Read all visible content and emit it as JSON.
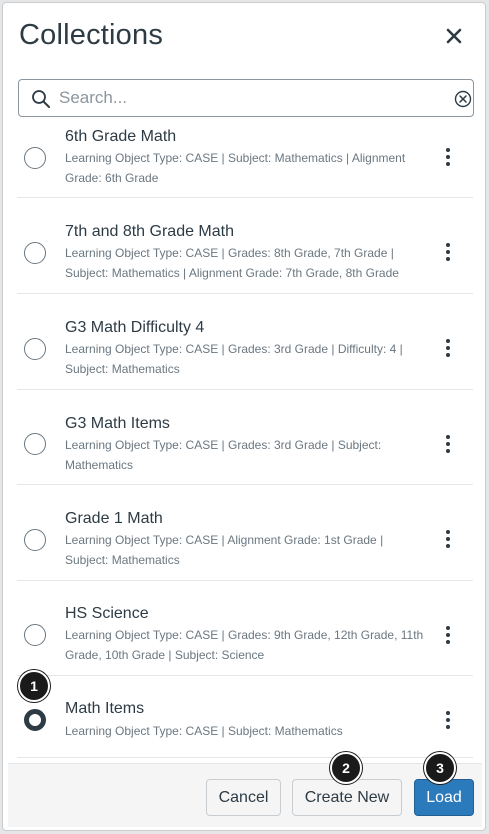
{
  "header": {
    "title": "Collections"
  },
  "search": {
    "placeholder": "Search...",
    "value": ""
  },
  "collections": [
    {
      "name": "6th Grade Math",
      "meta": "Learning Object Type: CASE | Subject: Mathematics | Alignment Grade: 6th Grade",
      "selected": false
    },
    {
      "name": "7th and 8th Grade Math",
      "meta": "Learning Object Type: CASE | Grades: 8th Grade, 7th Grade | Subject: Mathematics | Alignment Grade: 7th Grade, 8th Grade",
      "selected": false
    },
    {
      "name": "G3 Math Difficulty 4",
      "meta": "Learning Object Type: CASE | Grades: 3rd Grade | Difficulty: 4 | Subject: Mathematics",
      "selected": false
    },
    {
      "name": "G3 Math Items",
      "meta": "Learning Object Type: CASE | Grades: 3rd Grade | Subject: Mathematics",
      "selected": false
    },
    {
      "name": "Grade 1 Math",
      "meta": "Learning Object Type: CASE | Alignment Grade: 1st Grade | Subject: Mathematics",
      "selected": false
    },
    {
      "name": "HS Science",
      "meta": "Learning Object Type: CASE | Grades: 9th Grade, 12th Grade, 11th Grade, 10th Grade | Subject: Science",
      "selected": false
    },
    {
      "name": "Math Items",
      "meta": "Learning Object Type: CASE | Subject: Mathematics",
      "selected": true
    }
  ],
  "footer": {
    "cancel_label": "Cancel",
    "create_label": "Create New",
    "load_label": "Load"
  },
  "callouts": [
    "1",
    "2",
    "3"
  ],
  "colors": {
    "primary": "#2b7abc",
    "text": "#2d3b45",
    "muted": "#6b7780",
    "callout": "#1a1a1a"
  },
  "icons": {
    "close": "close-icon",
    "search": "search-icon",
    "clear": "clear-search-icon",
    "more": "more-options-icon"
  }
}
